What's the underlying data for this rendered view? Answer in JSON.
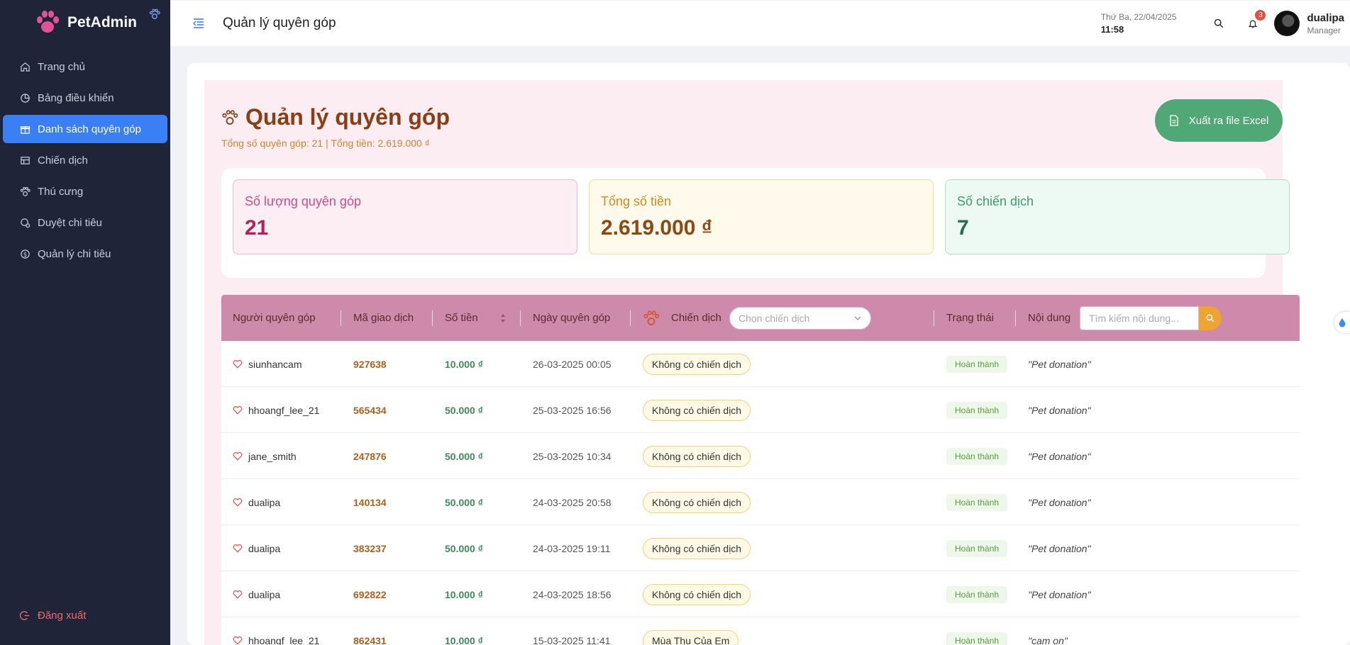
{
  "brand": {
    "name": "PetAdmin"
  },
  "sidebar": {
    "items": [
      {
        "label": "Trang chủ"
      },
      {
        "label": "Bảng điều khiển"
      },
      {
        "label": "Danh sách quyên góp"
      },
      {
        "label": "Chiến dịch"
      },
      {
        "label": "Thú cưng"
      },
      {
        "label": "Duyệt chi tiêu"
      },
      {
        "label": "Quản lý chi tiêu"
      }
    ],
    "logout": "Đăng xuất"
  },
  "header": {
    "title": "Quản lý quyên góp",
    "date": "Thứ Ba, 22/04/2025",
    "time": "11:58",
    "notification_count": "3",
    "user_name": "dualipa",
    "user_role": "Manager"
  },
  "page": {
    "title": "Quản lý quyên góp",
    "summary": "Tổng số quyên góp: 21 | Tổng tiền: 2.619.000 ₫",
    "export_label": "Xuất ra file Excel"
  },
  "stats": [
    {
      "label": "Số lượng quyên góp",
      "value": "21"
    },
    {
      "label": "Tổng số tiền",
      "value": "2.619.000 ₫"
    },
    {
      "label": "Số chiến dịch",
      "value": "7"
    }
  ],
  "table": {
    "headers": {
      "donor": "Người quyên góp",
      "tx": "Mã giao dịch",
      "amount": "Số tiền",
      "date": "Ngày quyên góp",
      "campaign": "Chiến dịch",
      "status": "Trạng thái",
      "content": "Nội dung"
    },
    "campaign_placeholder": "Chọn chiến dịch",
    "search_placeholder": "Tìm kiếm nội dung...",
    "rows": [
      {
        "donor": "siunhancam",
        "tx": "927638",
        "amount": "10.000 ₫",
        "date": "26-03-2025 00:05",
        "campaign": "Không có chiến dịch",
        "status": "Hoàn thành",
        "content": "\"Pet donation\""
      },
      {
        "donor": "hhoangf_lee_21",
        "tx": "565434",
        "amount": "50.000 ₫",
        "date": "25-03-2025 16:56",
        "campaign": "Không có chiến dịch",
        "status": "Hoàn thành",
        "content": "\"Pet donation\""
      },
      {
        "donor": "jane_smith",
        "tx": "247876",
        "amount": "50.000 ₫",
        "date": "25-03-2025 10:34",
        "campaign": "Không có chiến dịch",
        "status": "Hoàn thành",
        "content": "\"Pet donation\""
      },
      {
        "donor": "dualipa",
        "tx": "140134",
        "amount": "50.000 ₫",
        "date": "24-03-2025 20:58",
        "campaign": "Không có chiến dịch",
        "status": "Hoàn thành",
        "content": "\"Pet donation\""
      },
      {
        "donor": "dualipa",
        "tx": "383237",
        "amount": "50.000 ₫",
        "date": "24-03-2025 19:11",
        "campaign": "Không có chiến dịch",
        "status": "Hoàn thành",
        "content": "\"Pet donation\""
      },
      {
        "donor": "dualipa",
        "tx": "692822",
        "amount": "10.000 ₫",
        "date": "24-03-2025 18:56",
        "campaign": "Không có chiến dịch",
        "status": "Hoàn thành",
        "content": "\"Pet donation\""
      },
      {
        "donor": "hhoangf_lee_21",
        "tx": "862431",
        "amount": "10.000 ₫",
        "date": "15-03-2025 11:41",
        "campaign": "Mùa Thu Của Em",
        "status": "Hoàn thành",
        "content": "\"cam on\""
      }
    ]
  }
}
